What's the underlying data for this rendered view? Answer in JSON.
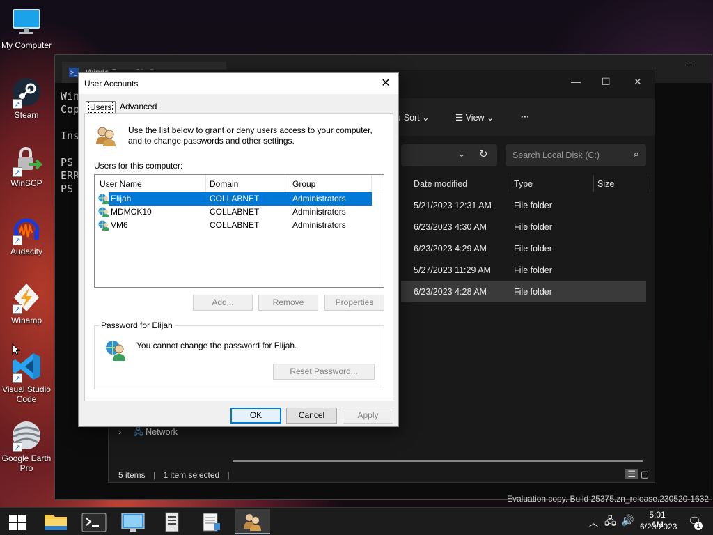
{
  "desktop": {
    "icons": [
      {
        "label": "My Computer"
      },
      {
        "label": "Steam"
      },
      {
        "label": "WinSCP"
      },
      {
        "label": "Audacity"
      },
      {
        "label": "Winamp"
      },
      {
        "label": "Visual Studio Code"
      },
      {
        "label": "Google Earth Pro"
      }
    ],
    "watermark": "Evaluation copy. Build 25375.zn_release.230520-1632"
  },
  "powershell": {
    "tab_title": "Windo  PowerShell",
    "lines": "Win\nCop\n\nIns\n\nPS\nERR\nPS"
  },
  "explorer": {
    "toolbar": {
      "sort": "Sort",
      "view": "View",
      "more": "···"
    },
    "search_placeholder": "Search Local Disk (C:)",
    "columns": {
      "date": "Date modified",
      "type": "Type",
      "size": "Size"
    },
    "rows": [
      {
        "date": "5/21/2023 12:31 AM",
        "type": "File folder"
      },
      {
        "date": "6/23/2023 4:30 AM",
        "type": "File folder"
      },
      {
        "date": "6/23/2023 4:29 AM",
        "type": "File folder"
      },
      {
        "date": "5/27/2023 11:29 AM",
        "type": "File folder"
      },
      {
        "date": "6/23/2023 4:28 AM",
        "type": "File folder"
      }
    ],
    "nav_network": "Network",
    "status_items": "5 items",
    "status_selected": "1 item selected"
  },
  "dialog": {
    "title": "User Accounts",
    "tabs": {
      "users": "Users",
      "advanced": "Advanced"
    },
    "intro": "Use the list below to grant or deny users access to your computer, and to change passwords and other settings.",
    "users_label": "Users for this computer:",
    "columns": {
      "name": "User Name",
      "domain": "Domain",
      "group": "Group"
    },
    "users": [
      {
        "name": "Elijah",
        "domain": "COLLABNET",
        "group": "Administrators"
      },
      {
        "name": "MDMCK10",
        "domain": "COLLABNET",
        "group": "Administrators"
      },
      {
        "name": "VM6",
        "domain": "COLLABNET",
        "group": "Administrators"
      }
    ],
    "buttons": {
      "add": "Add...",
      "remove": "Remove",
      "properties": "Properties"
    },
    "password_group": "Password for Elijah",
    "password_text": "You cannot change the password for Elijah.",
    "reset_password": "Reset Password...",
    "ok": "OK",
    "cancel": "Cancel",
    "apply": "Apply"
  },
  "taskbar": {
    "time": "5:01 AM",
    "date": "6/23/2023",
    "notification_count": "1"
  }
}
